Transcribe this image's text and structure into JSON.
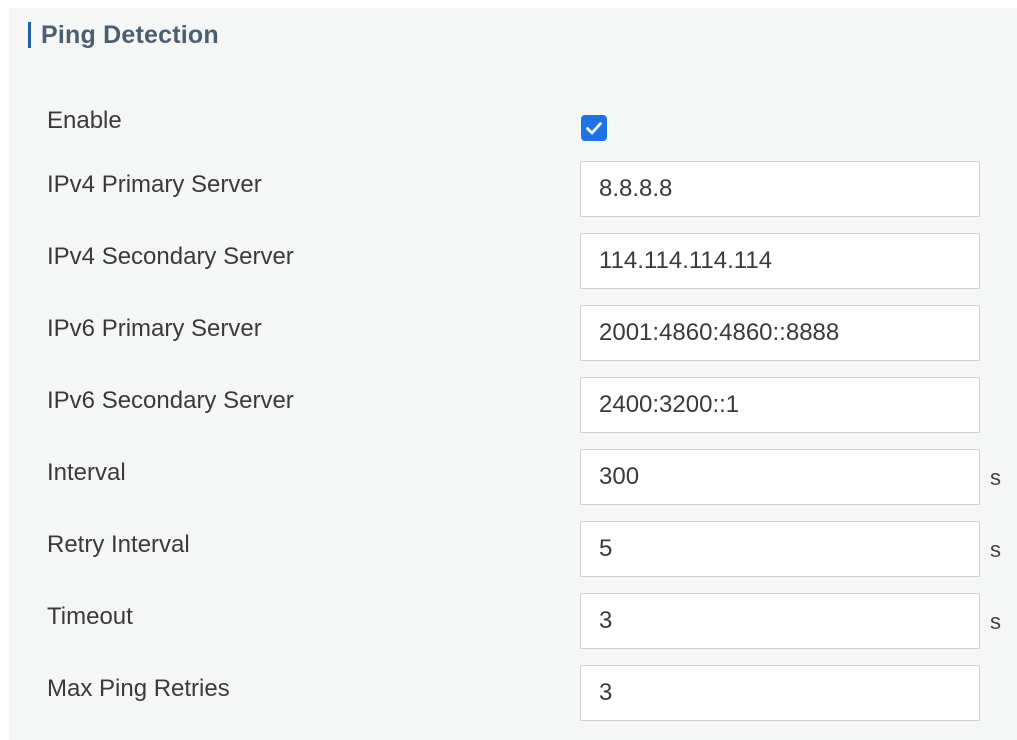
{
  "section": {
    "title": "Ping Detection"
  },
  "fields": {
    "enable": {
      "label": "Enable",
      "checked": true
    },
    "ipv4_primary": {
      "label": "IPv4 Primary Server",
      "value": "8.8.8.8"
    },
    "ipv4_secondary": {
      "label": "IPv4 Secondary Server",
      "value": "114.114.114.114"
    },
    "ipv6_primary": {
      "label": "IPv6 Primary Server",
      "value": "2001:4860:4860::8888"
    },
    "ipv6_secondary": {
      "label": "IPv6 Secondary Server",
      "value": "2400:3200::1"
    },
    "interval": {
      "label": "Interval",
      "value": "300",
      "unit": "s"
    },
    "retry_interval": {
      "label": "Retry Interval",
      "value": "5",
      "unit": "s"
    },
    "timeout": {
      "label": "Timeout",
      "value": "3",
      "unit": "s"
    },
    "max_ping_retries": {
      "label": "Max Ping Retries",
      "value": "3"
    }
  },
  "colors": {
    "accent": "#1a73e8",
    "title_bar": "#1f5fa8",
    "panel_bg": "#f5f6f6"
  }
}
